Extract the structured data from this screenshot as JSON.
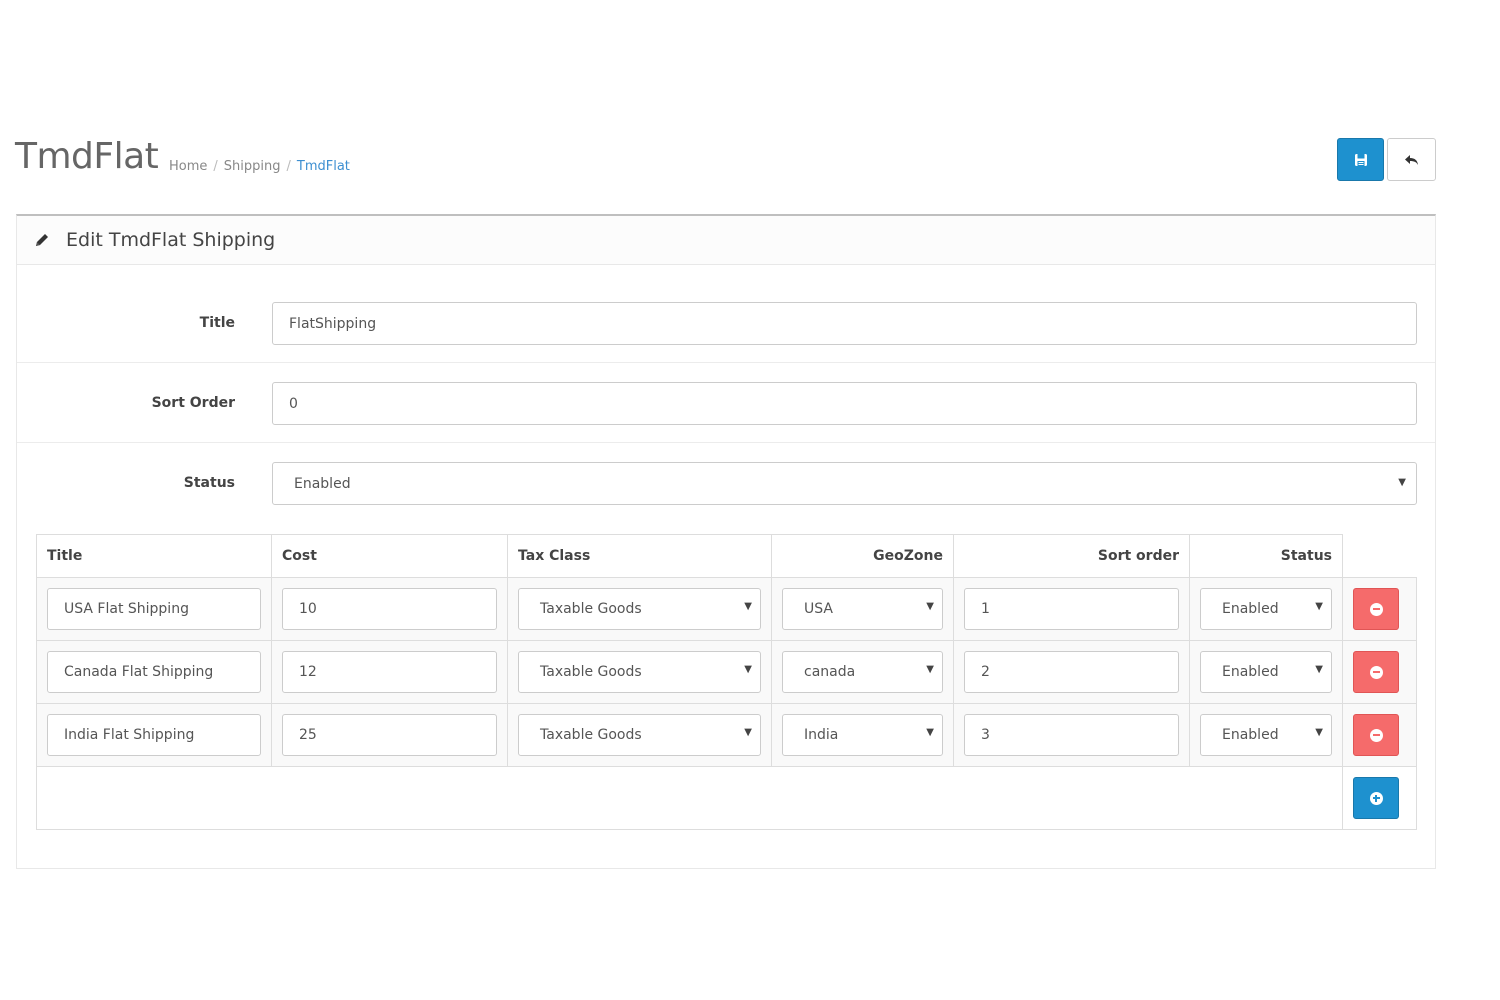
{
  "header": {
    "title": "TmdFlat",
    "breadcrumb": [
      "Home",
      "Shipping",
      "TmdFlat"
    ],
    "save_icon": "floppy-disk-icon",
    "back_icon": "reply-arrow-icon",
    "accent_color": "#1e91cf"
  },
  "panel": {
    "heading": "Edit TmdFlat Shipping",
    "heading_icon": "pencil-icon"
  },
  "form": {
    "title_label": "Title",
    "title_value": "FlatShipping",
    "sort_label": "Sort Order",
    "sort_value": "0",
    "status_label": "Status",
    "status_value": "Enabled"
  },
  "table": {
    "columns": [
      "Title",
      "Cost",
      "Tax Class",
      "GeoZone",
      "Sort order",
      "Status"
    ],
    "rows": [
      {
        "title": "USA Flat Shipping",
        "cost": "10",
        "tax_class": "Taxable Goods",
        "geozone": "USA",
        "sort_order": "1",
        "status": "Enabled"
      },
      {
        "title": "Canada Flat Shipping",
        "cost": "12",
        "tax_class": "Taxable Goods",
        "geozone": "canada",
        "sort_order": "2",
        "status": "Enabled"
      },
      {
        "title": "India Flat Shipping",
        "cost": "25",
        "tax_class": "Taxable Goods",
        "geozone": "India",
        "sort_order": "3",
        "status": "Enabled"
      }
    ],
    "remove_icon": "minus-circle-icon",
    "add_icon": "plus-circle-icon",
    "remove_color": "#f56b6b"
  }
}
